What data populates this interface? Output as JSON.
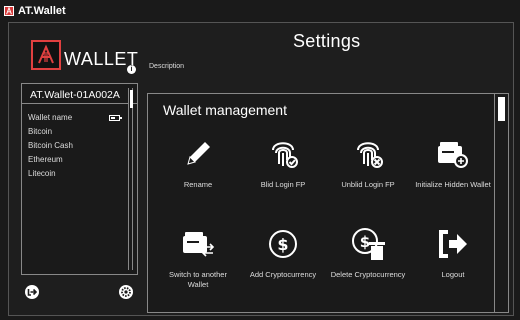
{
  "window": {
    "title": "AT.Wallet"
  },
  "brand": {
    "name": "WALLET"
  },
  "header": {
    "title": "Settings",
    "description": "Description"
  },
  "sidebar": {
    "wallet_id": "AT.Wallet-01A002A",
    "items": [
      {
        "label": "Wallet name"
      },
      {
        "label": "Bitcoin"
      },
      {
        "label": "Bitcoin Cash"
      },
      {
        "label": "Ethereum"
      },
      {
        "label": "Litecoin"
      }
    ]
  },
  "panel": {
    "title": "Wallet management",
    "actions": [
      {
        "label": "Rename",
        "icon": "pencil-icon"
      },
      {
        "label": "Blid Login FP",
        "icon": "fingerprint-icon"
      },
      {
        "label": "Unblid Login FP",
        "icon": "fingerprint-icon"
      },
      {
        "label": "Initialize Hidden Wallet",
        "icon": "wallet-icon"
      },
      {
        "label": "Switch to another Wallet",
        "icon": "wallet-switch-icon"
      },
      {
        "label": "Add Cryptocurrency",
        "icon": "dollar-circle-icon"
      },
      {
        "label": "Delete Cryptocurrency",
        "icon": "dollar-trash-icon"
      },
      {
        "label": "Logout",
        "icon": "logout-icon"
      }
    ]
  },
  "colors": {
    "accent": "#e04040",
    "background": "#1e1e1e",
    "text": "#ffffff"
  }
}
